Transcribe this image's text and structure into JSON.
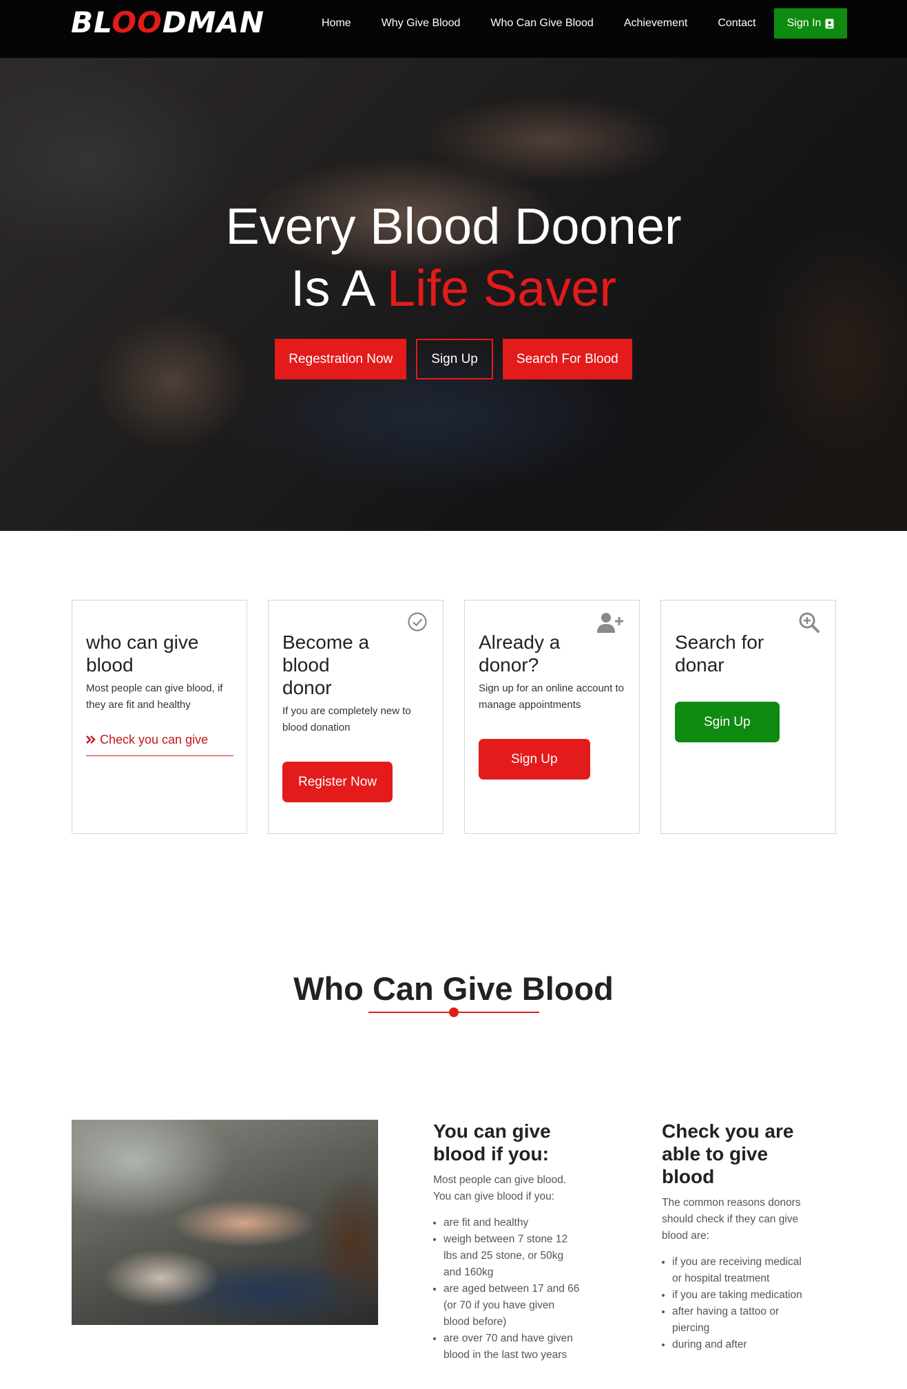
{
  "navbar": {
    "logo_prefix": "BL",
    "logo_accent": "OO",
    "logo_suffix": "DMAN",
    "links": [
      "Home",
      "Why Give Blood",
      "Who Can Give Blood",
      "Achievement",
      "Contact"
    ],
    "signin_label": "Sign In",
    "signin_icon": "user-card-icon"
  },
  "hero": {
    "line1": "Every Blood Dooner",
    "line2_prefix": "Is A",
    "line2_accent": "Life Saver",
    "buttons": [
      "Regestration Now",
      "Sign Up",
      "Search For Blood"
    ]
  },
  "cards": [
    {
      "title": "who can give blood",
      "text": "Most people can give blood, if they are fit and healthy",
      "link_label": "Check you can give",
      "icon": "double-chevron-right-icon"
    },
    {
      "title": "Become a blood donor",
      "text": "If you are completely new to blood donation",
      "button_label": "Register Now",
      "icon": "check-circle-icon"
    },
    {
      "title": "Already a donor?",
      "text": "Sign up for an online account to manage appointments",
      "button_label": "Sign Up",
      "icon": "user-plus-icon"
    },
    {
      "title": "Search for donar",
      "button_label": "Sgin Up",
      "icon": "zoom-in-icon"
    }
  ],
  "section": {
    "title": "Who Can Give Blood"
  },
  "eligibility": {
    "heading": "You can give blood if you:",
    "intro": "Most people can give blood. You can give blood if you:",
    "items": [
      "are fit and healthy",
      "weigh between 7 stone 12 lbs and 25 stone, or 50kg and 160kg",
      "are aged between 17 and 66 (or 70 if you have given blood before)",
      "are over 70 and have given blood in the last two years"
    ]
  },
  "check": {
    "heading": "Check you are able to give blood",
    "intro": "The common reasons donors should check if they can give blood are:",
    "items": [
      "if you are receiving medical or hospital treatment",
      "if you are taking medication",
      "after having a tattoo or piercing",
      "during and after"
    ]
  },
  "colors": {
    "accent": "#e31b1b",
    "signin_green": "#0f8a11",
    "navbar_bg": "#050505"
  }
}
